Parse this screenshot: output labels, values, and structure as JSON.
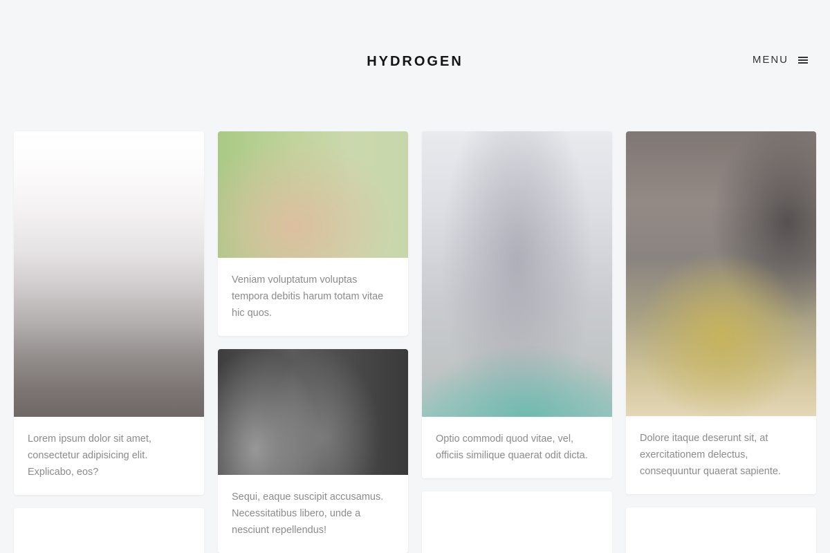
{
  "header": {
    "brand": "HYDROGEN",
    "menu_label": "MENU"
  },
  "cards": [
    {
      "text": "Lorem ipsum dolor sit amet, consectetur adipisicing elit. Explicabo, eos?"
    },
    {
      "text": "Veniam voluptatum voluptas tempora debitis harum totam vitae hic quos."
    },
    {
      "text": "Sequi, eaque suscipit accusamus. Necessitatibus libero, unde a nesciunt repellendus!"
    },
    {
      "text": "Optio commodi quod vitae, vel, officiis similique quaerat odit dicta."
    },
    {
      "text": "Dolore itaque deserunt sit, at exercitationem delectus, consequuntur quaerat sapiente."
    }
  ],
  "icons": {
    "menu": "hamburger-icon"
  },
  "colors": {
    "background": "#f4f6f8",
    "card": "#ffffff",
    "text_muted": "#8b8b8b",
    "brand": "#141414"
  }
}
